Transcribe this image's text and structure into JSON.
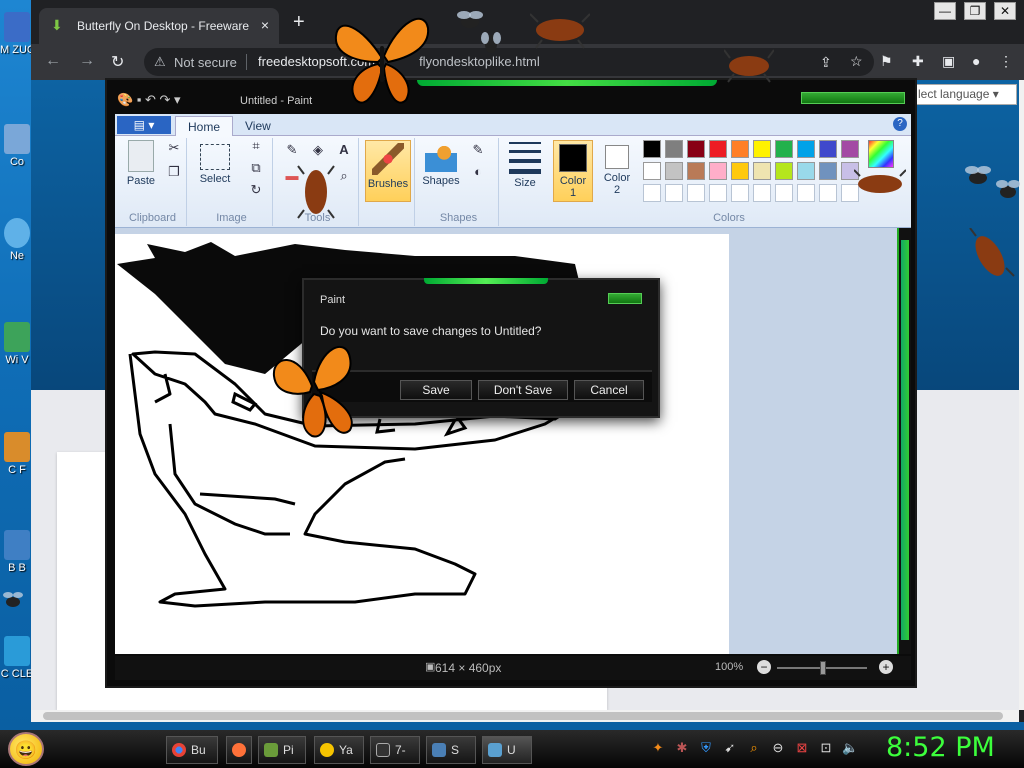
{
  "desktop": {
    "icons": [
      {
        "label": "M ZUC"
      },
      {
        "label": "Co"
      },
      {
        "label": "Ne"
      },
      {
        "label": "Wi V"
      },
      {
        "label": "C F"
      },
      {
        "label": "B B"
      },
      {
        "label": "C CLE"
      }
    ]
  },
  "browser": {
    "tab_title": "Butterfly On Desktop - Freeware",
    "tab_close": "×",
    "new_tab": "+",
    "window_controls": [
      "—",
      "❐",
      "✕"
    ],
    "security_text": "Not secure",
    "url_domain": "freedesktopsoft.com",
    "url_path": "flyondesktoplike.html",
    "language_select": "lect language ▾"
  },
  "paint": {
    "window_title": "Untitled - Paint",
    "file_button": "▤ ▾",
    "tabs": [
      "Home",
      "View"
    ],
    "help": "?",
    "groups": {
      "clipboard": {
        "label": "Clipboard",
        "paste": "Paste"
      },
      "image": {
        "label": "Image",
        "select": "Select"
      },
      "tools": {
        "label": "Tools"
      },
      "brushes": {
        "label": "Brushes"
      },
      "shapes": {
        "label": "Shapes",
        "shapes_btn": "Shapes"
      },
      "size": {
        "label": "Size"
      },
      "colors": {
        "label": "Colors",
        "color1": "Color 1",
        "color2": "Color 2",
        "edit": "colors"
      }
    },
    "palette_row1": [
      "#000000",
      "#7f7f7f",
      "#880015",
      "#ed1c24",
      "#ff7f27",
      "#fff200",
      "#22b14c",
      "#00a2e8",
      "#3f48cc",
      "#a349a4"
    ],
    "palette_row2": [
      "#ffffff",
      "#c3c3c3",
      "#b97a57",
      "#ffaec9",
      "#ffc90e",
      "#efe4b0",
      "#b5e61d",
      "#99d9ea",
      "#7092be",
      "#c8bfe7"
    ],
    "palette_row3": [
      "#ffffff",
      "#ffffff",
      "#ffffff",
      "#ffffff",
      "#ffffff",
      "#ffffff",
      "#ffffff",
      "#ffffff",
      "#ffffff",
      "#ffffff"
    ],
    "status_dims": "614 × 460px",
    "zoom": "100%"
  },
  "dialog": {
    "title": "Paint",
    "message": "Do you want to save changes to Untitled?",
    "save": "Save",
    "dont_save": "Don't Save",
    "cancel": "Cancel"
  },
  "taskbar": {
    "items": [
      {
        "label": "Bu",
        "color": "#e94235"
      },
      {
        "label": "",
        "color": "#ff7139"
      },
      {
        "label": "Pi",
        "color": "#6a9c3a"
      },
      {
        "label": "Ya",
        "color": "#f6c400"
      },
      {
        "label": "7-",
        "color": "#333333"
      },
      {
        "label": "S",
        "color": "#4a7fb5"
      },
      {
        "label": "U",
        "color": "#5aa0d0"
      }
    ],
    "clock": "8:52 PM"
  }
}
